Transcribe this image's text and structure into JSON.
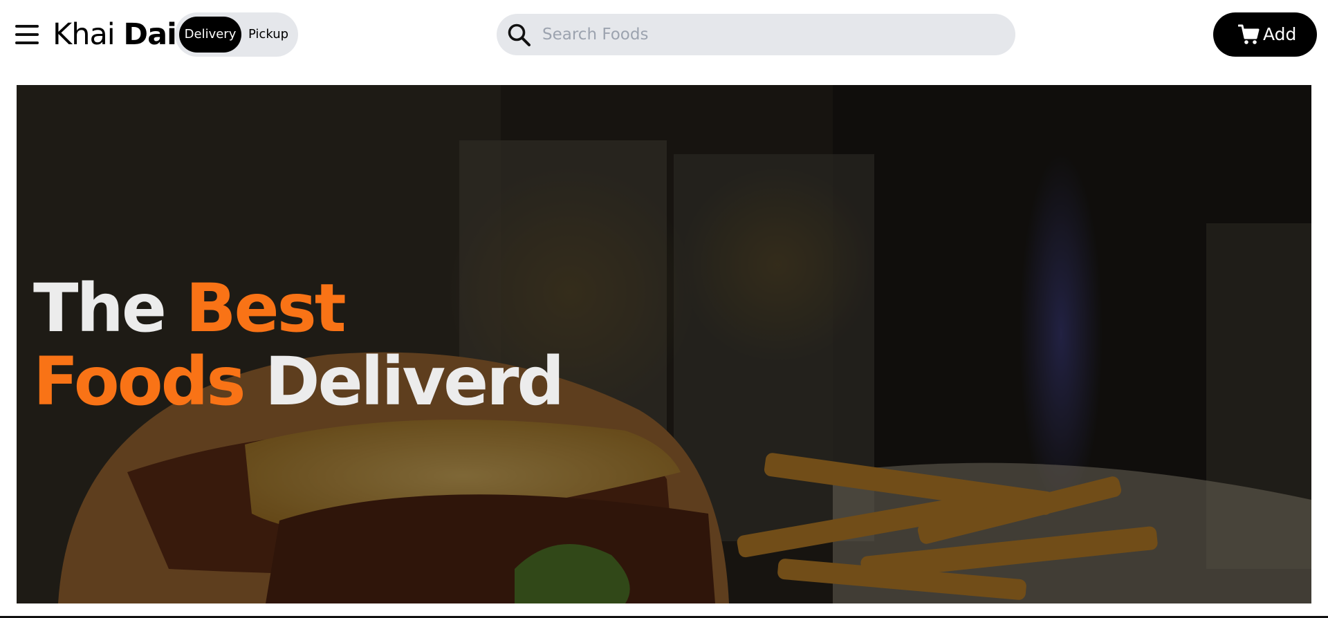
{
  "header": {
    "menu_icon": "hamburger-menu-icon",
    "brand": {
      "light": "Khai",
      "bold": "Dai"
    },
    "mode_toggle": {
      "options": [
        "Delivery",
        "Pickup"
      ],
      "selected": "Delivery"
    },
    "search": {
      "placeholder": "Search Foods",
      "value": "",
      "icon": "search-icon"
    },
    "cart": {
      "label": "Add",
      "icon": "cart-icon"
    }
  },
  "hero": {
    "line1_plain": "The",
    "line1_accent": "Best",
    "line2_accent": "Foods",
    "line2_plain": "Deliverd"
  },
  "colors": {
    "accent": "#f97316",
    "hero_text": "#ececec",
    "pill_bg": "#e5e7eb",
    "dark": "#000000"
  }
}
